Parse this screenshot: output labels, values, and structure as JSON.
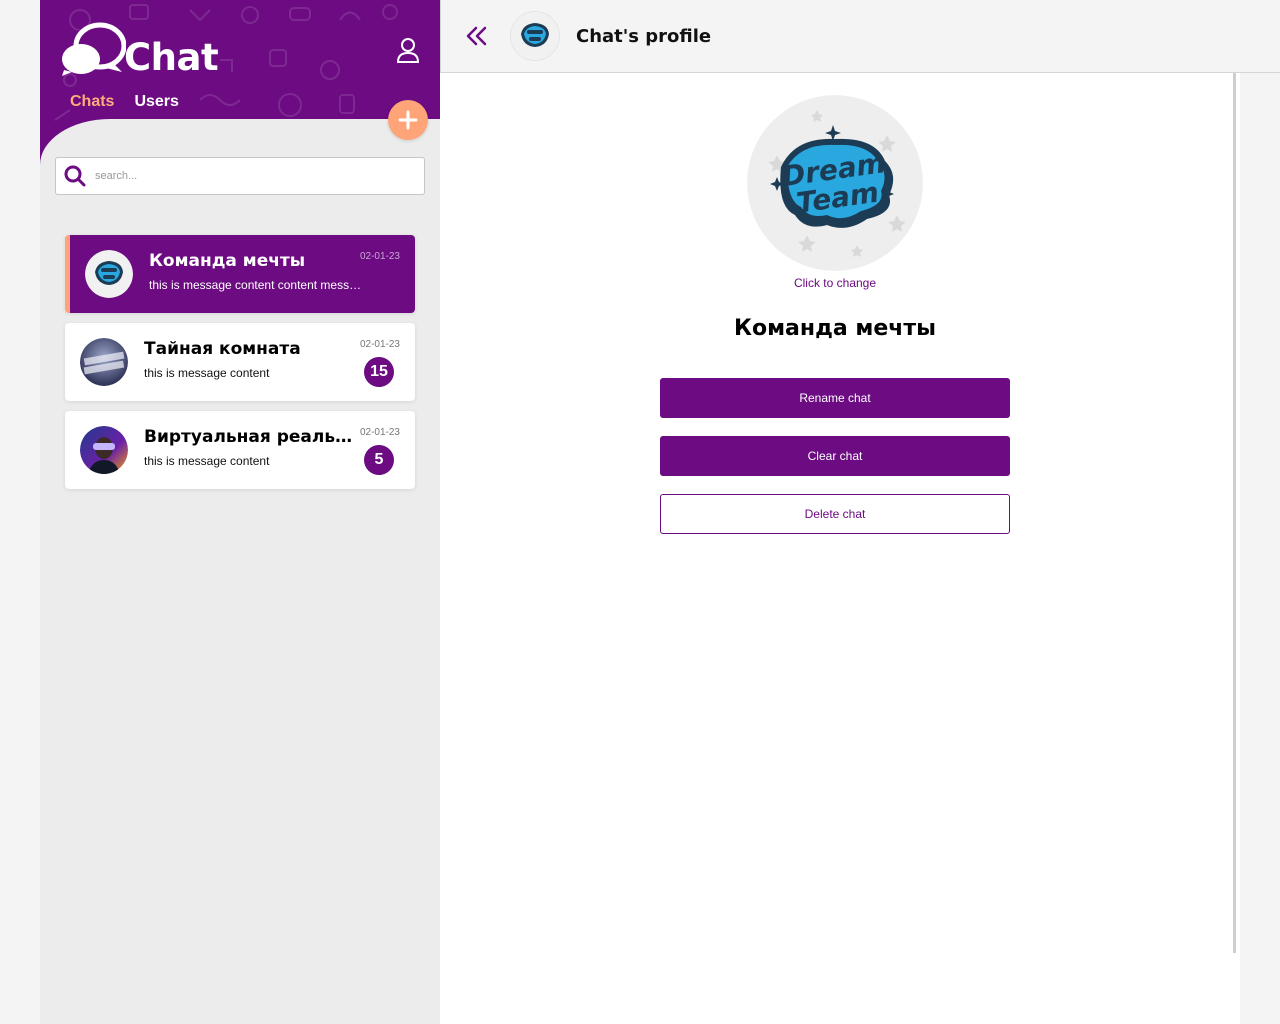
{
  "colors": {
    "brand": "#6c0b82",
    "accent": "#ffa478",
    "tab_active": "#ffab7a"
  },
  "sidebar": {
    "logo_text": "Chat",
    "tabs": [
      {
        "label": "Chats",
        "active": true
      },
      {
        "label": "Users",
        "active": false
      }
    ],
    "search_placeholder": "search...",
    "add_icon": "plus-icon",
    "profile_icon": "user-icon",
    "chats": [
      {
        "name": "Команда мечты",
        "message": "this is message content content messa...",
        "date": "02-01-23",
        "unread": null,
        "active": true
      },
      {
        "name": "Тайная комната",
        "message": "this is message content",
        "date": "02-01-23",
        "unread": "15",
        "active": false
      },
      {
        "name": "Виртуальная реальность",
        "message": "this is message content",
        "date": "02-01-23",
        "unread": "5",
        "active": false
      }
    ]
  },
  "header": {
    "back_icon": "double-chevron-left-icon",
    "title": "Chat's profile"
  },
  "profile": {
    "change_label": "Click to change",
    "chat_name": "Команда мечты",
    "avatar_lettering": [
      "Dream",
      "Team"
    ],
    "buttons": {
      "rename": "Rename chat",
      "clear": "Clear chat",
      "delete": "Delete chat"
    }
  }
}
